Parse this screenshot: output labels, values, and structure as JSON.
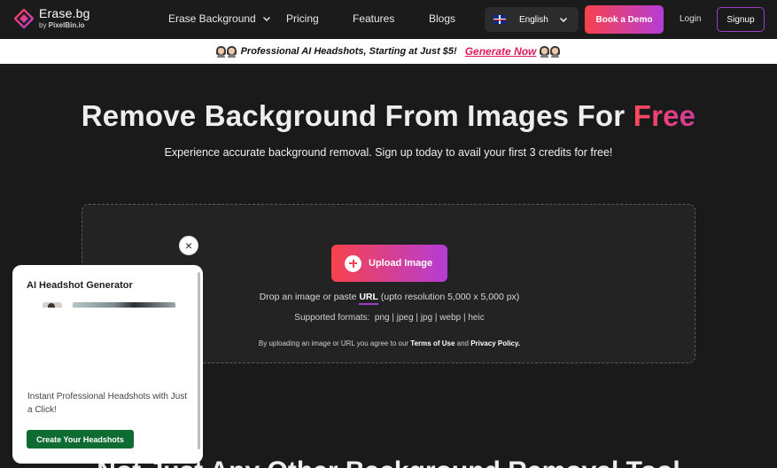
{
  "brand": {
    "name": "Erase.bg",
    "by": "by ",
    "by_brand": "PixelBin.io",
    "accent_gradient": [
      "#f8424c",
      "#b53cd6"
    ]
  },
  "nav": {
    "links": [
      {
        "label": "Erase Background",
        "has_dropdown": true
      },
      {
        "label": "Pricing"
      },
      {
        "label": "Features"
      },
      {
        "label": "Blogs"
      }
    ],
    "language": "English",
    "book_demo": "Book a Demo",
    "login": "Login",
    "signup": "Signup"
  },
  "banner": {
    "text": "Professional AI Headshots, Starting at Just $5!",
    "cta": "Generate Now"
  },
  "hero": {
    "title_main": "Remove Background From Images For ",
    "title_highlight": "Free",
    "subtitle": "Experience accurate background removal. Sign up today to avail your first 3 credits for free!"
  },
  "upload": {
    "button": "Upload Image",
    "drop_prefix": "Drop an image or paste ",
    "drop_link": "URL",
    "drop_suffix": " (upto resolution 5,000 x 5,000 px)",
    "formats_label": "Supported formats:",
    "formats": "png | jpeg | jpg | webp | heic",
    "terms_prefix": "By uploading an image or URL you agree to our ",
    "terms_link": "Terms of Use",
    "terms_and": " and ",
    "privacy_link": "Privacy Policy."
  },
  "next_section_title": "Not Just Any Other Background Removal Tool",
  "popup": {
    "title": "AI Headshot Generator",
    "description": "Instant Professional Headshots with Just a Click!",
    "cta": "Create Your Headshots",
    "close": "×"
  }
}
